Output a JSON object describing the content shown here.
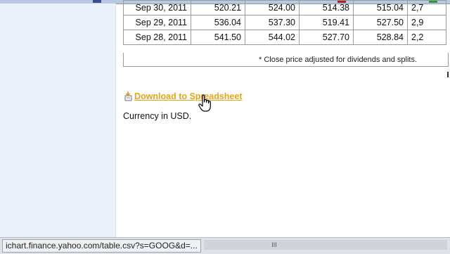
{
  "history_table": {
    "rows": [
      {
        "date": "Sep 30, 2011",
        "open": "520.21",
        "high": "524.00",
        "low": "514.38",
        "close": "515.04",
        "volume": "2,7"
      },
      {
        "date": "Sep 29, 2011",
        "open": "536.04",
        "high": "537.30",
        "low": "519.41",
        "close": "527.50",
        "volume": "2,9"
      },
      {
        "date": "Sep 28, 2011",
        "open": "541.50",
        "high": "544.02",
        "low": "527.70",
        "close": "528.84",
        "volume": "2,2"
      }
    ],
    "footnote": "* Close price adjusted for dividends and splits."
  },
  "download": {
    "label": "Download to Spreadsheet"
  },
  "currency_note": "Currency in USD.",
  "statusbar": {
    "url": "ichart.finance.yahoo.com/table.csv?s=GOOG&d=...",
    "grip": "III"
  },
  "colors": {
    "link": "#e8a316",
    "panel": "#eaf1fb"
  }
}
